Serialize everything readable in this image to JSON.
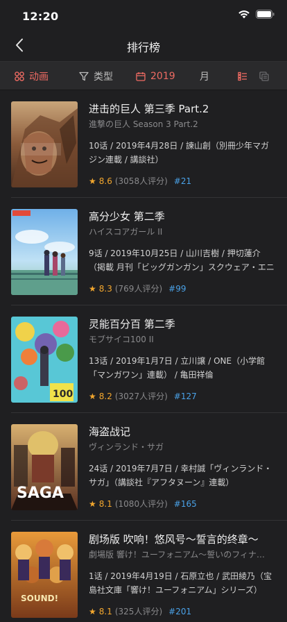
{
  "status": {
    "time": "12:20"
  },
  "nav": {
    "title": "排行榜"
  },
  "filters": {
    "anime": "动画",
    "type": "类型",
    "year": "2019",
    "month": "月"
  },
  "colors": {
    "accent": "#ef6b63",
    "rating": "#f3a72e",
    "rank": "#4aa2e8",
    "background": "#1f1f21"
  },
  "items": [
    {
      "title": "进击的巨人 第三季 Part.2",
      "subtitle": "進撃の巨人 Season 3 Part.2",
      "info": "10话 / 2019年4月28日 / 諫山創（別冊少年マガジン連載 / 講談社）",
      "score": "8.6",
      "votes": "(3058人评分)",
      "rank": "#21"
    },
    {
      "title": "高分少女 第二季",
      "subtitle": "ハイスコアガール II",
      "info": "9话 / 2019年10月25日 / 山川吉樹 / 押切蓮介（掲載 月刊「ビッグガンガン」スクウェア・エニックス）",
      "score": "8.3",
      "votes": "(769人评分)",
      "rank": "#99"
    },
    {
      "title": "灵能百分百 第二季",
      "subtitle": "モブサイコ100 II",
      "info": "13话 / 2019年1月7日 / 立川譲 / ONE（小学館「マンガワン」連載） / 亀田祥倫",
      "score": "8.2",
      "votes": "(3027人评分)",
      "rank": "#127"
    },
    {
      "title": "海盗战记",
      "subtitle": "ヴィンランド・サガ",
      "info": "24话 / 2019年7月7日 / 幸村誠「ヴィンランド・サガ」（講談社『アフタヌーン』連載）",
      "score": "8.1",
      "votes": "(1080人评分)",
      "rank": "#165"
    },
    {
      "title": "剧场版 吹响！悠风号～誓言的终章～",
      "subtitle": "劇場版 響け！ユーフォニアム～誓いのフィナーレ～",
      "info": "1话 / 2019年4月19日 / 石原立也 / 武田綾乃（宝島社文庫「響け！ユーフォニアム」シリーズ）",
      "score": "8.1",
      "votes": "(325人评分)",
      "rank": "#201"
    }
  ]
}
